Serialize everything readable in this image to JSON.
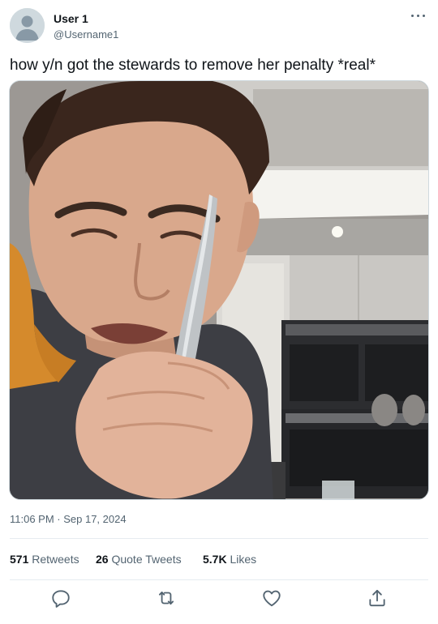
{
  "user": {
    "display_name": "User 1",
    "handle": "@Username1",
    "avatar_icon": "default-avatar-icon"
  },
  "menu_icon": "more-horizontal-icon",
  "tweet": {
    "text": "how y/n got the stewards to remove her penalty *real*",
    "media_description_icon": "photo",
    "timestamp": "11:06 PM · Sep 17, 2024"
  },
  "stats": {
    "retweets_count": "571",
    "retweets_label": "Retweets",
    "quotes_count": "26",
    "quotes_label": "Quote Tweets",
    "likes_count": "5.7K",
    "likes_label": "Likes"
  },
  "actions": [
    {
      "icon": "reply-icon"
    },
    {
      "icon": "retweet-icon"
    },
    {
      "icon": "like-icon"
    },
    {
      "icon": "share-icon"
    }
  ],
  "colors": {
    "text_primary": "#0f1419",
    "text_secondary": "#536471",
    "divider": "#e6ecf0",
    "action_icon": "#536471"
  }
}
